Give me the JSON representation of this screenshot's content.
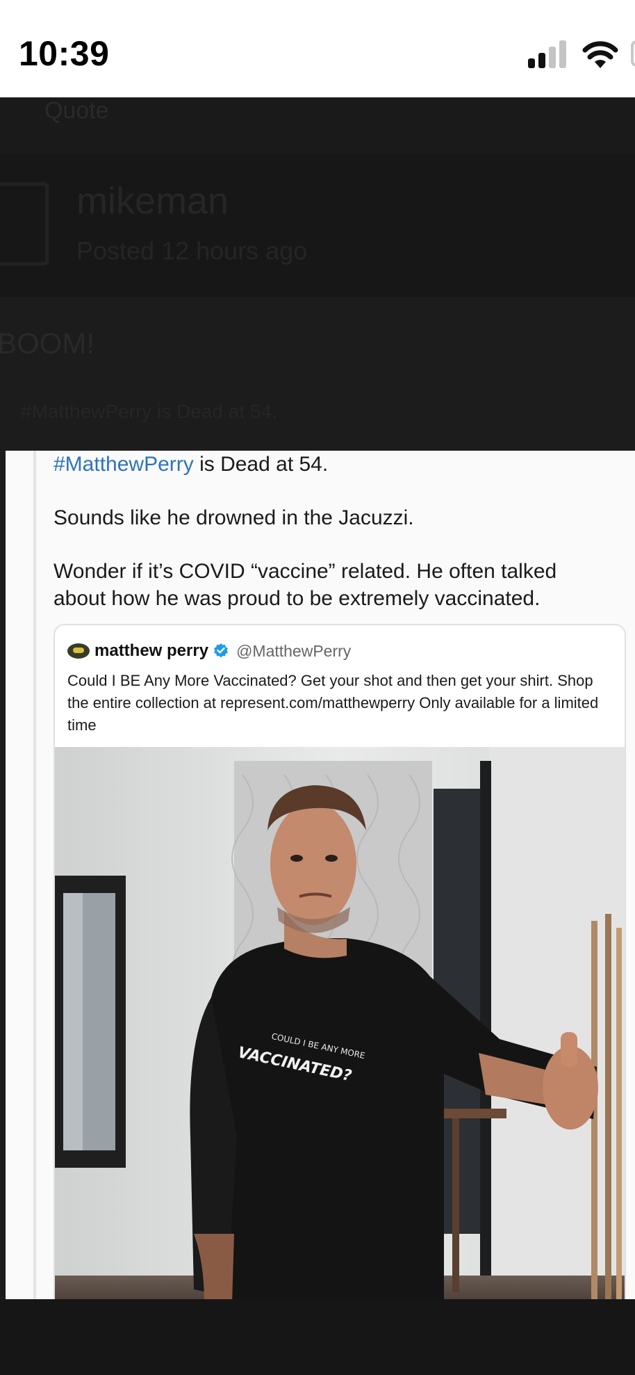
{
  "status_bar": {
    "time": "10:39",
    "signal_icon": "cellular-signal-icon",
    "wifi_icon": "wifi-icon",
    "battery_icon": "battery-icon"
  },
  "forum": {
    "quote_label": "Quote",
    "username": "mikeman",
    "posted": "Posted 12 hours ago",
    "boom": "BOOM!",
    "faded_line": "#MatthewPerry is Dead at 54."
  },
  "post": {
    "hashtag": "#MatthewPerry",
    "line1_rest": " is Dead at 54.",
    "line2": "Sounds like he drowned in the Jacuzzi.",
    "line3": "Wonder if it’s COVID “vaccine” related. He often talked about how he was proud to be extremely vaccinated."
  },
  "quoted_tweet": {
    "name": "matthew perry",
    "handle": "@MatthewPerry",
    "verified_icon": "verified-badge-icon",
    "body": "Could I BE Any More Vaccinated? Get your shot and then get your shirt. Shop the entire collection at represent.com/matthewperry Only available for a limited time",
    "photo": {
      "shirt_line1": "COULD I BE ANY MORE",
      "shirt_line2": "VACCINATED?"
    }
  },
  "colors": {
    "hashtag": "#2d73bf",
    "verified": "#1d9bf0",
    "forum_bg": "#1c1c1d"
  }
}
